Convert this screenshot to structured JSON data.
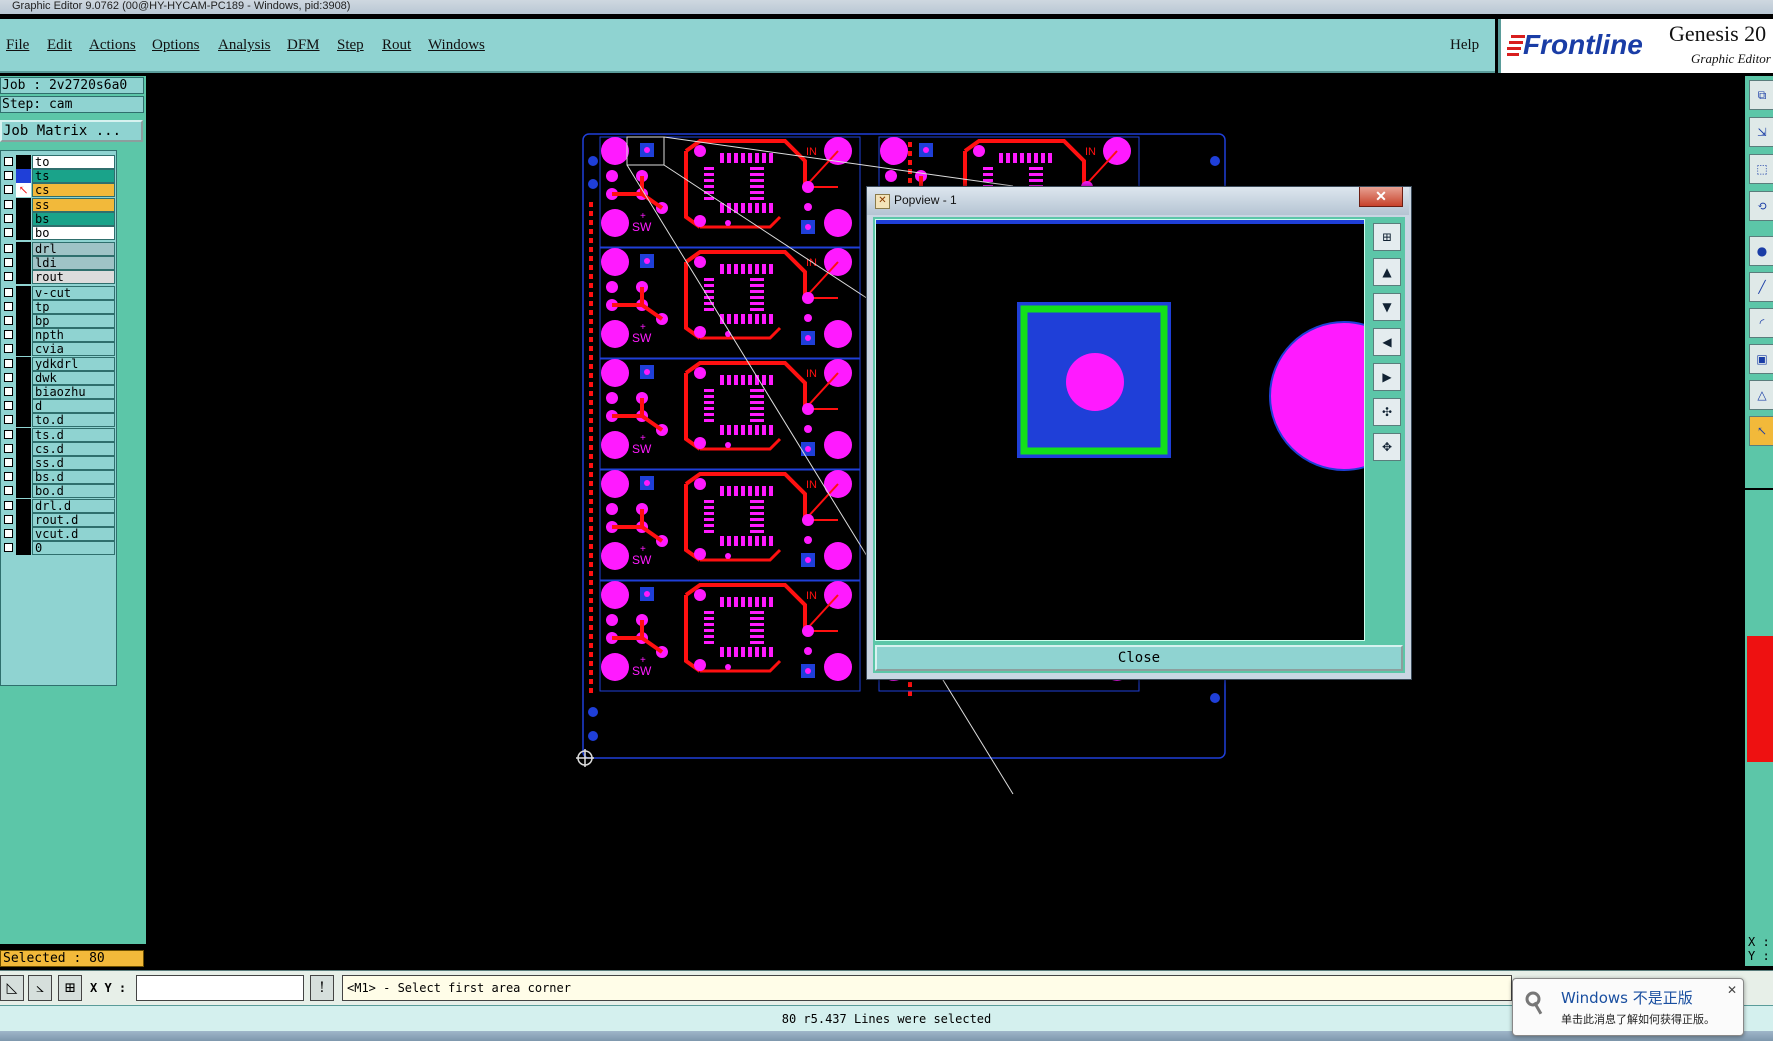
{
  "window": {
    "title": "Graphic Editor 9.0762 (00@HY-HYCAM-PC189 - Windows, pid:3908)"
  },
  "menu": {
    "items": [
      "File",
      "Edit",
      "Actions",
      "Options",
      "Analysis",
      "DFM",
      "Step",
      "Rout",
      "Windows"
    ],
    "help": "Help"
  },
  "brand": {
    "logo": "Frontline",
    "product": "Genesis 20",
    "subtitle": "Graphic Editor"
  },
  "sidebar": {
    "job": "Job : 2v2720s6a0",
    "step": "Step: cam",
    "job_matrix": "Job Matrix ...",
    "layers": [
      {
        "name": "to",
        "color": "#ffffff",
        "tag": "#000000"
      },
      {
        "name": "ts",
        "color": "#1aa38a",
        "tag": "#1f3fd8"
      },
      {
        "name": "cs",
        "color": "#f2b93a",
        "tag": "#000000",
        "active": true
      },
      {
        "name": "ss",
        "color": "#f2b93a",
        "tag": "#000000"
      },
      {
        "name": "bs",
        "color": "#1aa38a",
        "tag": "#000000"
      },
      {
        "name": "bo",
        "color": "#ffffff",
        "tag": "#000000"
      },
      {
        "name": "drl",
        "color": "#9fc3c6",
        "tag": "#000000"
      },
      {
        "name": "ldi",
        "color": "#9fc3c6",
        "tag": "#000000"
      },
      {
        "name": "rout",
        "color": "#dcdcdc",
        "tag": "#000000"
      },
      {
        "name": "v-cut",
        "color": "#8fd3d1",
        "tag": "#000000"
      },
      {
        "name": "tp",
        "color": "#8fd3d1",
        "tag": "#000000"
      },
      {
        "name": "bp",
        "color": "#8fd3d1",
        "tag": "#000000"
      },
      {
        "name": "npth",
        "color": "#8fd3d1",
        "tag": "#000000"
      },
      {
        "name": "cvia",
        "color": "#8fd3d1",
        "tag": "#000000"
      },
      {
        "name": "ydkdrl",
        "color": "#8fd3d1",
        "tag": "#000000"
      },
      {
        "name": "dwk",
        "color": "#8fd3d1",
        "tag": "#000000"
      },
      {
        "name": "biaozhu",
        "color": "#8fd3d1",
        "tag": "#000000"
      },
      {
        "name": "d",
        "color": "#8fd3d1",
        "tag": "#000000"
      },
      {
        "name": "to.d",
        "color": "#8fd3d1",
        "tag": "#000000"
      },
      {
        "name": "ts.d",
        "color": "#8fd3d1",
        "tag": "#000000"
      },
      {
        "name": "cs.d",
        "color": "#8fd3d1",
        "tag": "#000000"
      },
      {
        "name": "ss.d",
        "color": "#8fd3d1",
        "tag": "#000000"
      },
      {
        "name": "bs.d",
        "color": "#8fd3d1",
        "tag": "#000000"
      },
      {
        "name": "bo.d",
        "color": "#8fd3d1",
        "tag": "#000000"
      },
      {
        "name": "drl.d",
        "color": "#8fd3d1",
        "tag": "#000000"
      },
      {
        "name": "rout.d",
        "color": "#8fd3d1",
        "tag": "#000000"
      },
      {
        "name": "vcut.d",
        "color": "#8fd3d1",
        "tag": "#000000"
      },
      {
        "name": "0",
        "color": "#8fd3d1",
        "tag": "#000000"
      }
    ],
    "selected": "Selected : 80"
  },
  "popview": {
    "title": "Popview - 1",
    "close_x": "✕",
    "close_button": "Close"
  },
  "board": {
    "pad_color": "#ff1aff",
    "trace_color": "#ff1010",
    "via_color": "#1f3fd8",
    "outline_color": "#1f3fd8",
    "silk_labels": [
      "SW",
      "IN",
      "+"
    ]
  },
  "bottom": {
    "xy_label": "X Y :",
    "xy_value": "",
    "prompt": "<M1> - Select first area corner",
    "status": "80 r5.437 Lines were selected"
  },
  "right_xy": {
    "x": "X :",
    "y": "Y :"
  },
  "notification": {
    "title": "Windows 不是正版",
    "body": "单击此消息了解如何获得正版。"
  }
}
